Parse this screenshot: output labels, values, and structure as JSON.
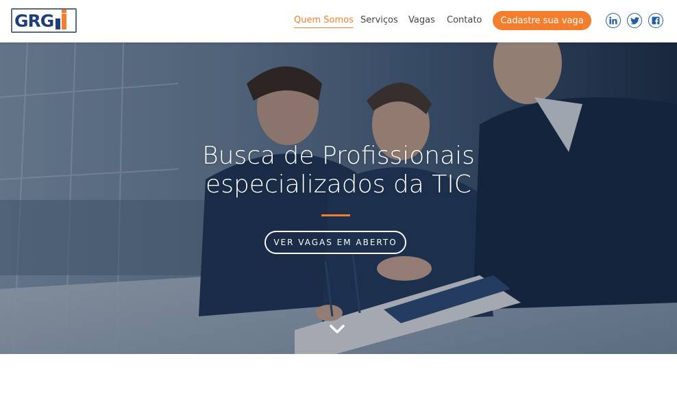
{
  "brand": {
    "logo_text": "GRG",
    "accent_color": "#f47e2d",
    "primary_color": "#1f3f7a"
  },
  "nav": {
    "items": [
      {
        "label": "Quem Somos",
        "active": true
      },
      {
        "label": "Serviços",
        "active": false
      },
      {
        "label": "Vagas",
        "active": false
      },
      {
        "label": "Contato",
        "active": false
      }
    ],
    "cta_label": "Cadastre sua vaga"
  },
  "social": [
    {
      "icon": "linkedin-icon",
      "glyph": "in"
    },
    {
      "icon": "twitter-icon",
      "glyph": "🐦"
    },
    {
      "icon": "facebook-icon",
      "glyph": "f"
    }
  ],
  "hero": {
    "title_line1": "Busca de Profissionais",
    "title_line2": "especializados da TIC",
    "button_label": "VER VAGAS EM ABERTO",
    "scroll_icon": "chevron-down-icon"
  }
}
